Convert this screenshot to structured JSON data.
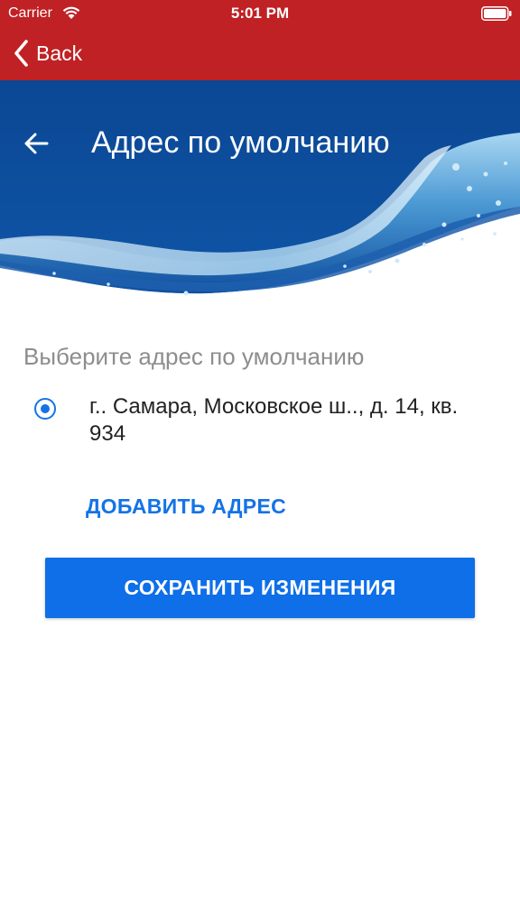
{
  "status_bar": {
    "carrier": "Carrier",
    "time": "5:01 PM"
  },
  "nav": {
    "back_label": "Back"
  },
  "header": {
    "title": "Адрес по умолчанию"
  },
  "content": {
    "section_label": "Выберите адрес по умолчанию",
    "addresses": [
      {
        "text": "г.. Самара, Московское ш.., д. 14, кв. 934",
        "selected": true
      }
    ],
    "add_address_label": "ДОБАВИТЬ АДРЕС",
    "save_label": "СОХРАНИТЬ ИЗМЕНЕНИЯ"
  },
  "colors": {
    "nav_bar": "#c02124",
    "header_blue": "#0c4a96",
    "accent": "#1473e6",
    "button": "#0e6fe8"
  },
  "icons": {
    "back": "chevron-left-icon",
    "header_back": "arrow-left-icon",
    "wifi": "wifi-icon",
    "battery": "battery-icon",
    "radio": "radio-selected-icon"
  }
}
